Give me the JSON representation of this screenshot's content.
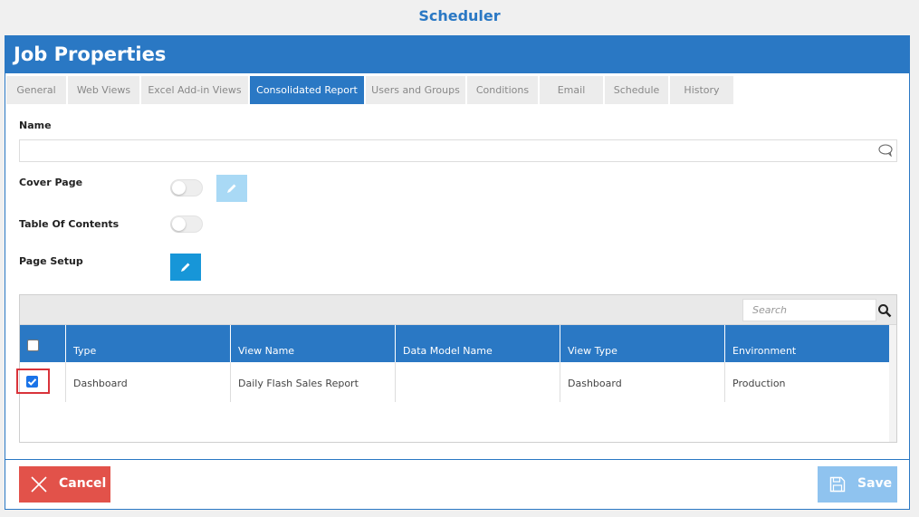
{
  "app": {
    "title": "Scheduler"
  },
  "panel": {
    "title": "Job Properties"
  },
  "tabs": [
    {
      "label": "General",
      "active": false
    },
    {
      "label": "Web Views",
      "active": false
    },
    {
      "label": "Excel Add-in Views",
      "active": false
    },
    {
      "label": "Consolidated Report",
      "active": true
    },
    {
      "label": "Users and Groups",
      "active": false
    },
    {
      "label": "Conditions",
      "active": false
    },
    {
      "label": "Email",
      "active": false
    },
    {
      "label": "Schedule",
      "active": false
    },
    {
      "label": "History",
      "active": false
    }
  ],
  "form": {
    "name_label": "Name",
    "name_value": "",
    "cover_page_label": "Cover Page",
    "cover_page_enabled": false,
    "toc_label": "Table Of Contents",
    "toc_enabled": false,
    "page_setup_label": "Page Setup"
  },
  "grid": {
    "search_placeholder": "Search",
    "columns": [
      "Type",
      "View Name",
      "Data Model Name",
      "View Type",
      "Environment"
    ],
    "rows": [
      {
        "checked": true,
        "cells": [
          "Dashboard",
          "Daily Flash Sales Report",
          "",
          "Dashboard",
          "Production"
        ]
      }
    ]
  },
  "footer": {
    "cancel_label": "Cancel",
    "save_label": "Save"
  },
  "colors": {
    "primary": "#2a78c4",
    "cancel": "#e2524a",
    "save_disabled": "#8fc3ef",
    "edit_enabled": "#1796d8",
    "edit_disabled": "#a9d9f5"
  },
  "icons": {
    "name_field": "speech-bubble-icon",
    "edit": "pencil-icon",
    "search": "search-icon",
    "cancel": "close-icon",
    "save": "floppy-disk-icon"
  }
}
